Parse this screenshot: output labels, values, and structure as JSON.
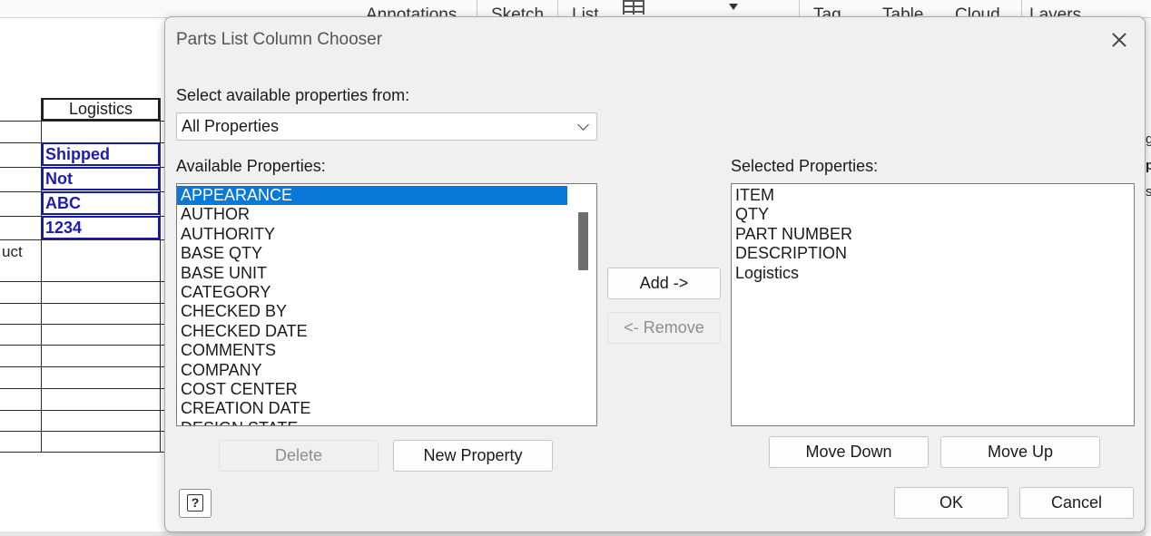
{
  "background": {
    "ribbon_labels": [
      "Annotations",
      "Sketch",
      "List",
      "Tag",
      "Table",
      "Cloud",
      "Layers"
    ],
    "column_header": "Logistics",
    "cells": [
      "Shipped",
      "Not",
      "ABC",
      "1234"
    ],
    "row_fragment": "uct",
    "right_fragments": [
      "g",
      "p",
      "s"
    ]
  },
  "dialog": {
    "title": "Parts List Column Chooser",
    "source_label": "Select available properties from:",
    "source_value": "All Properties",
    "available_label": "Available Properties:",
    "available_items": [
      "APPEARANCE",
      "AUTHOR",
      "AUTHORITY",
      "BASE QTY",
      "BASE UNIT",
      "CATEGORY",
      "CHECKED BY",
      "CHECKED DATE",
      "COMMENTS",
      "COMPANY",
      "COST CENTER",
      "CREATION DATE",
      "DESIGN STATE"
    ],
    "available_selected_index": 0,
    "selected_label": "Selected Properties:",
    "selected_items": [
      "ITEM",
      "QTY",
      "PART NUMBER",
      "DESCRIPTION",
      "Logistics"
    ],
    "buttons": {
      "add": "Add ->",
      "remove": "<- Remove",
      "delete": "Delete",
      "new_property": "New Property",
      "move_down": "Move Down",
      "move_up": "Move Up",
      "ok": "OK",
      "cancel": "Cancel",
      "help": "?"
    },
    "colors": {
      "selection": "#0a78d7",
      "cell_text": "#1c1cb4"
    }
  }
}
